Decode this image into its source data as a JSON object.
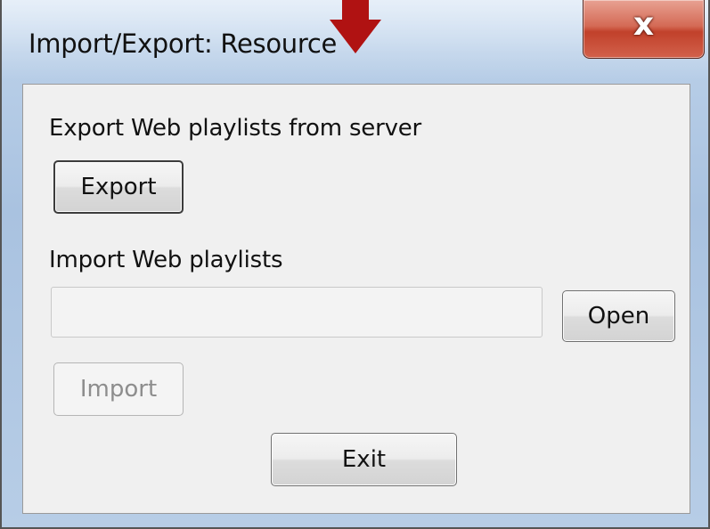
{
  "window": {
    "title": "Import/Export: Resource",
    "close_glyph": "x"
  },
  "export_section": {
    "label": "Export Web playlists from server",
    "export_button": "Export"
  },
  "import_section": {
    "label": "Import Web playlists",
    "file_path_value": "",
    "open_button": "Open",
    "import_button": "Import"
  },
  "exit_button": "Exit",
  "annotation": {
    "arrow_color": "#b01212"
  }
}
